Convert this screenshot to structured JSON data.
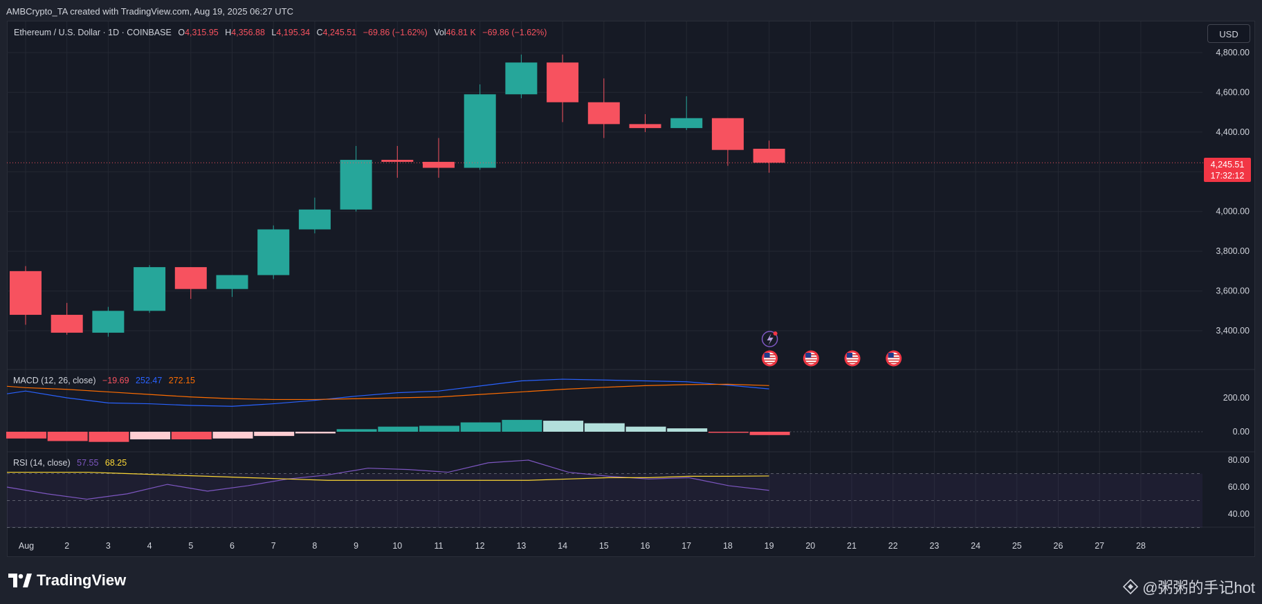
{
  "credit": "AMBCrypto_TA created with TradingView.com, Aug 19, 2025 06:27 UTC",
  "legend": {
    "symbol": "Ethereum / U.S. Dollar · 1D · COINBASE",
    "o_label": "O",
    "o_value": "4,315.95",
    "h_label": "H",
    "h_value": "4,356.88",
    "l_label": "L",
    "l_value": "4,195.34",
    "c_label": "C",
    "c_value": "4,245.51",
    "change": "−69.86 (−1.62%)",
    "vol_label": "Vol",
    "vol_value": "46.81 K",
    "vol_change": "−69.86 (−1.62%)"
  },
  "currency_button": "USD",
  "last_price": {
    "price": "4,245.51",
    "countdown": "17:32:12"
  },
  "macd_legend": {
    "label": "MACD (12, 26, close)",
    "hist": "−19.69",
    "macd": "252.47",
    "signal": "272.15"
  },
  "rsi_legend": {
    "label": "RSI (14, close)",
    "rsi": "57.55",
    "ma": "68.25"
  },
  "footer": {
    "logo_text": "TradingView",
    "watermark": "@粥粥的手记hot"
  },
  "colors": {
    "up": "#26a69a",
    "down": "#f7525f",
    "macd_line": "#2962ff",
    "signal_line": "#ff6d00",
    "rsi_line": "#7e57c2",
    "rsi_ma": "#fdd835",
    "background": "#161a25",
    "grid": "#242833"
  },
  "icons": [
    "lightning-icon",
    "us-flag-icon"
  ],
  "chart_data": [
    {
      "type": "candlestick",
      "title": "Ethereum / U.S. Dollar · 1D · COINBASE",
      "x": [
        "Aug 1",
        "2",
        "3",
        "4",
        "5",
        "6",
        "7",
        "8",
        "9",
        "10",
        "11",
        "12",
        "13",
        "14",
        "15",
        "16",
        "17",
        "18",
        "19"
      ],
      "x_axis_ticks": [
        "Aug",
        "2",
        "3",
        "4",
        "5",
        "6",
        "7",
        "8",
        "9",
        "10",
        "11",
        "12",
        "13",
        "14",
        "15",
        "16",
        "17",
        "18",
        "19",
        "20",
        "21",
        "22",
        "23",
        "24",
        "25",
        "26",
        "27",
        "28"
      ],
      "ohlc": [
        [
          3700,
          3725,
          3430,
          3480
        ],
        [
          3480,
          3540,
          3380,
          3390
        ],
        [
          3390,
          3520,
          3370,
          3500
        ],
        [
          3500,
          3730,
          3490,
          3720
        ],
        [
          3720,
          3720,
          3560,
          3610
        ],
        [
          3610,
          3680,
          3570,
          3680
        ],
        [
          3680,
          3930,
          3660,
          3910
        ],
        [
          3910,
          4070,
          3890,
          4010
        ],
        [
          4010,
          4330,
          4000,
          4260
        ],
        [
          4260,
          4330,
          4170,
          4250
        ],
        [
          4250,
          4370,
          4170,
          4220
        ],
        [
          4220,
          4640,
          4210,
          4590
        ],
        [
          4590,
          4790,
          4570,
          4750
        ],
        [
          4750,
          4790,
          4450,
          4550
        ],
        [
          4550,
          4670,
          4370,
          4440
        ],
        [
          4440,
          4490,
          4400,
          4420
        ],
        [
          4420,
          4580,
          4410,
          4470
        ],
        [
          4470,
          4470,
          4230,
          4310
        ],
        [
          4315.95,
          4356.88,
          4195.34,
          4245.51
        ]
      ],
      "y_ticks": [
        "3,400.00",
        "3,600.00",
        "3,800.00",
        "4,000.00",
        "4,200.00",
        "4,400.00",
        "4,600.00",
        "4,800.00"
      ],
      "ylim": [
        3290,
        4880
      ]
    },
    {
      "type": "line",
      "title": "MACD (12, 26, close)",
      "series": [
        {
          "name": "MACD",
          "values": [
            240,
            200,
            170,
            165,
            155,
            150,
            165,
            185,
            210,
            230,
            240,
            270,
            300,
            310,
            305,
            300,
            295,
            275,
            252.47
          ]
        },
        {
          "name": "Signal",
          "values": [
            260,
            250,
            235,
            220,
            205,
            195,
            190,
            190,
            195,
            200,
            205,
            220,
            235,
            250,
            262,
            272,
            278,
            280,
            272.15
          ]
        },
        {
          "name": "Histogram",
          "values": [
            -40,
            -55,
            -60,
            -45,
            -45,
            -40,
            -25,
            -10,
            15,
            30,
            35,
            55,
            70,
            65,
            50,
            30,
            20,
            -5,
            -19.69
          ]
        }
      ],
      "y_ticks": [
        "0.00",
        "200.00"
      ],
      "ylim": [
        -90,
        380
      ]
    },
    {
      "type": "line",
      "title": "RSI (14, close)",
      "series": [
        {
          "name": "RSI",
          "values": [
            60,
            55,
            51,
            55,
            62,
            57,
            61,
            66,
            69,
            74,
            73,
            71,
            78,
            80,
            71,
            68,
            66,
            67,
            61,
            57.55
          ]
        },
        {
          "name": "RSI MA",
          "values": [
            71,
            71,
            71,
            70,
            69,
            68,
            67,
            66,
            65,
            65,
            65,
            65,
            65,
            65,
            66,
            67,
            67,
            68,
            68,
            68.25
          ]
        }
      ],
      "bands": [
        30,
        50,
        70
      ],
      "y_ticks": [
        "40.00",
        "60.00",
        "80.00"
      ],
      "ylim": [
        30,
        84
      ]
    }
  ]
}
